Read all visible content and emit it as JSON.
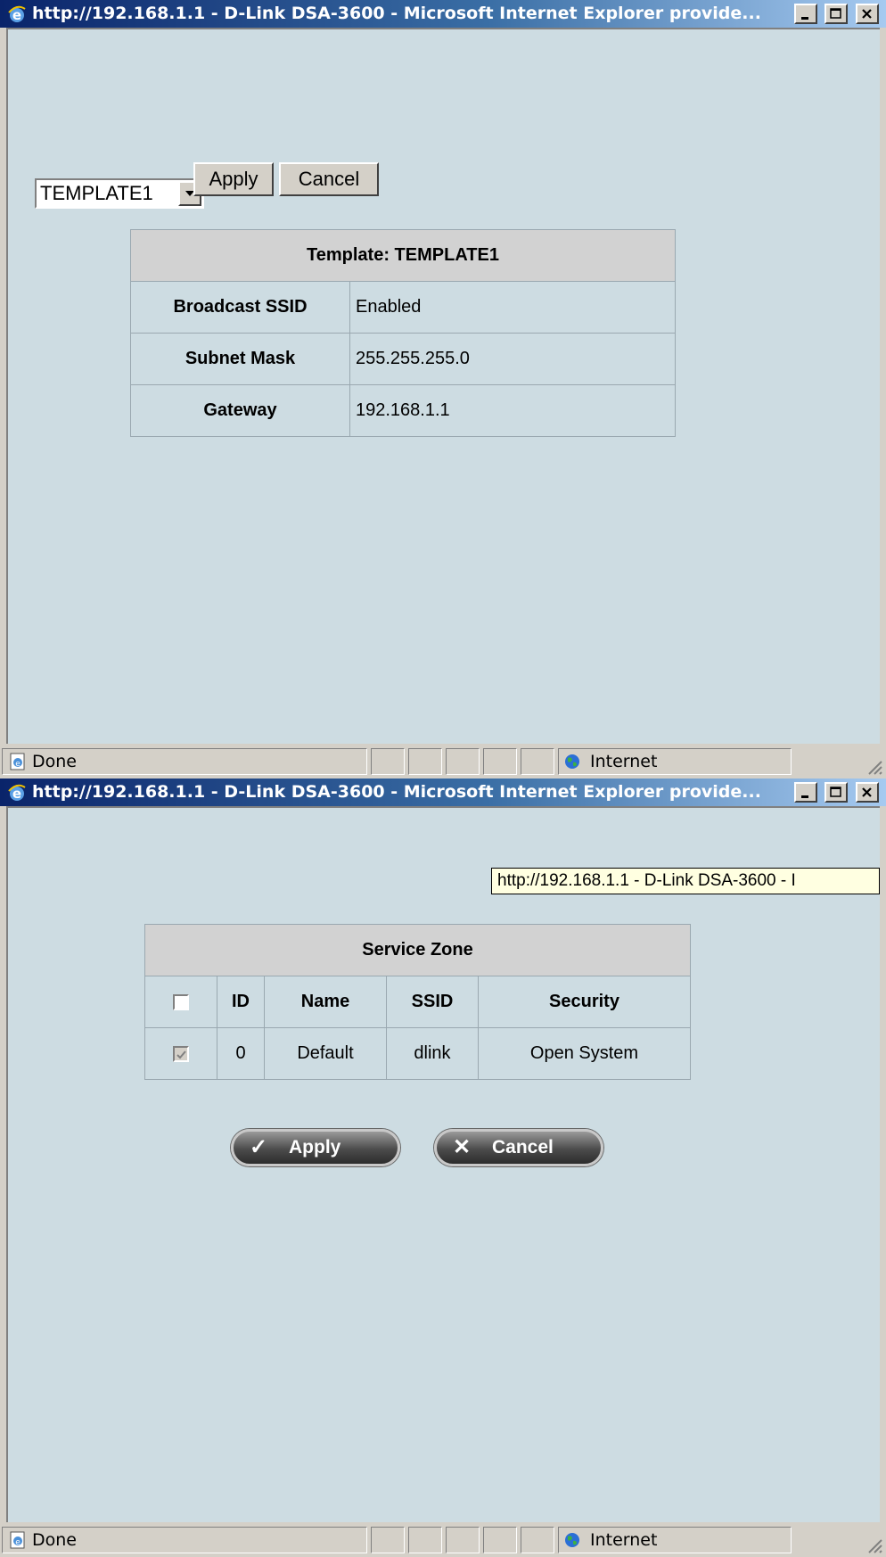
{
  "window1": {
    "title": "http://192.168.1.1 - D-Link DSA-3600 - Microsoft Internet Explorer provide...",
    "template_select": {
      "value": "TEMPLATE1"
    },
    "apply_label": "Apply",
    "cancel_label": "Cancel",
    "template_table": {
      "header": "Template: TEMPLATE1",
      "rows": [
        {
          "label": "Broadcast SSID",
          "value": "Enabled"
        },
        {
          "label": "Subnet Mask",
          "value": "255.255.255.0"
        },
        {
          "label": "Gateway",
          "value": "192.168.1.1"
        }
      ]
    },
    "status": {
      "text": "Done",
      "zone": "Internet"
    }
  },
  "window2": {
    "title": "http://192.168.1.1 - D-Link DSA-3600 - Microsoft Internet Explorer provide...",
    "tooltip": "http://192.168.1.1 - D-Link DSA-3600 - I",
    "service_zone_table": {
      "title": "Service Zone",
      "columns": [
        "",
        "ID",
        "Name",
        "SSID",
        "Security"
      ],
      "rows": [
        {
          "checked": true,
          "disabled": true,
          "id": "0",
          "name": "Default",
          "ssid": "dlink",
          "security": "Open System"
        }
      ]
    },
    "apply_label": "Apply",
    "cancel_label": "Cancel",
    "status": {
      "text": "Done",
      "zone": "Internet"
    }
  }
}
